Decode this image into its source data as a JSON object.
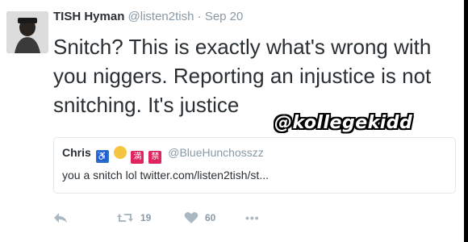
{
  "tweet": {
    "author_name": "TISH Hyman",
    "author_handle": "@listen2tish",
    "separator": "·",
    "timestamp": "Sep 20",
    "text_lines": [
      "Snitch? This is exactly what's wrong with",
      "you niggers. Reporting an injustice is not",
      "snitching. It's justice"
    ]
  },
  "watermark": "@kollegekidd",
  "quoted_tweet": {
    "author_name": "Chris",
    "emoji_icons": [
      "wheelchair-icon",
      "construction-worker-icon",
      "full-sign-icon",
      "prohibited-sign-icon"
    ],
    "author_handle": "@BlueHunchosszz",
    "text": "you a snitch lol twitter.com/listen2tish/st..."
  },
  "actions": {
    "retweet_count": "19",
    "like_count": "60",
    "more_label": "•••"
  },
  "colors": {
    "text": "#292f33",
    "muted": "#8899a6",
    "icon": "#aab8c2",
    "border": "#e1e8ed"
  }
}
